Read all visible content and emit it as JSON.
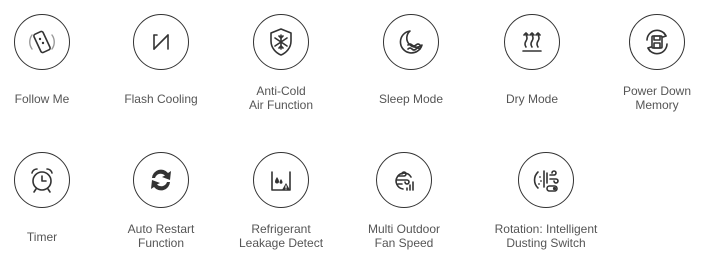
{
  "features": [
    {
      "icon": "follow-me-icon",
      "lines": [
        "Follow Me"
      ]
    },
    {
      "icon": "flash-cooling-icon",
      "lines": [
        "Flash Cooling"
      ]
    },
    {
      "icon": "anti-cold-icon",
      "lines": [
        "Anti-Cold",
        "Air Function"
      ]
    },
    {
      "icon": "sleep-mode-icon",
      "lines": [
        "Sleep Mode"
      ]
    },
    {
      "icon": "dry-mode-icon",
      "lines": [
        "Dry Mode"
      ]
    },
    {
      "icon": "power-down-memory-icon",
      "lines": [
        "Power Down",
        "Memory"
      ]
    },
    {
      "icon": "timer-icon",
      "lines": [
        "Timer"
      ]
    },
    {
      "icon": "auto-restart-icon",
      "lines": [
        "Auto Restart",
        "Function"
      ]
    },
    {
      "icon": "refrigerant-leakage-icon",
      "lines": [
        "Refrigerant",
        "Leakage Detect"
      ]
    },
    {
      "icon": "fan-speed-icon",
      "lines": [
        "Multi Outdoor",
        "Fan Speed"
      ]
    },
    {
      "icon": "dusting-switch-icon",
      "lines": [
        "Rotation: Intelligent",
        "Dusting Switch"
      ]
    }
  ],
  "colors": {
    "icon_stroke": "#333333",
    "label_text": "#555555",
    "background": "#ffffff"
  }
}
